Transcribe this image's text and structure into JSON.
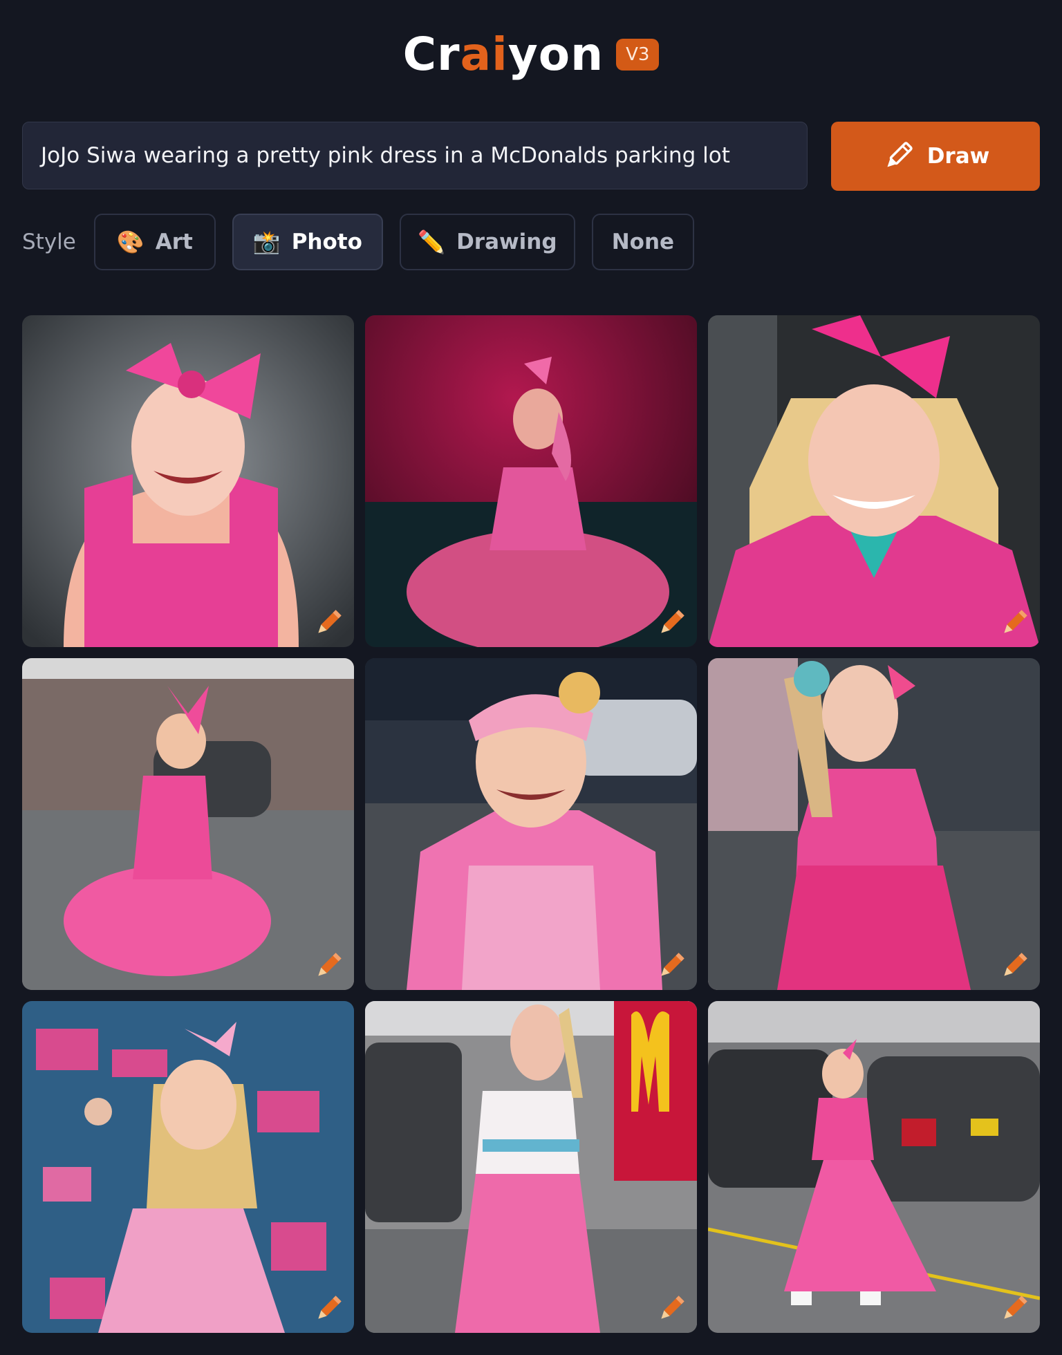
{
  "header": {
    "logo_prefix": "Cr",
    "logo_ai": "ai",
    "logo_suffix": "yon",
    "version_badge": "V3"
  },
  "prompt": {
    "value": "JoJo Siwa wearing a pretty pink dress in a McDonalds parking lot"
  },
  "draw_button": {
    "label": "Draw",
    "icon": "pencil-icon"
  },
  "style": {
    "label": "Style",
    "options": [
      {
        "label": "Art",
        "icon": "palette-icon",
        "selected": false
      },
      {
        "label": "Photo",
        "icon": "camera-flash-icon",
        "selected": true
      },
      {
        "label": "Drawing",
        "icon": "pencil-icon",
        "selected": false
      },
      {
        "label": "None",
        "icon": "",
        "selected": false
      }
    ]
  },
  "results": {
    "count": 9,
    "edit_icon": "pencil-edit-icon"
  },
  "colors": {
    "background": "#141721",
    "accent": "#d3591a",
    "input_bg": "#222637"
  }
}
